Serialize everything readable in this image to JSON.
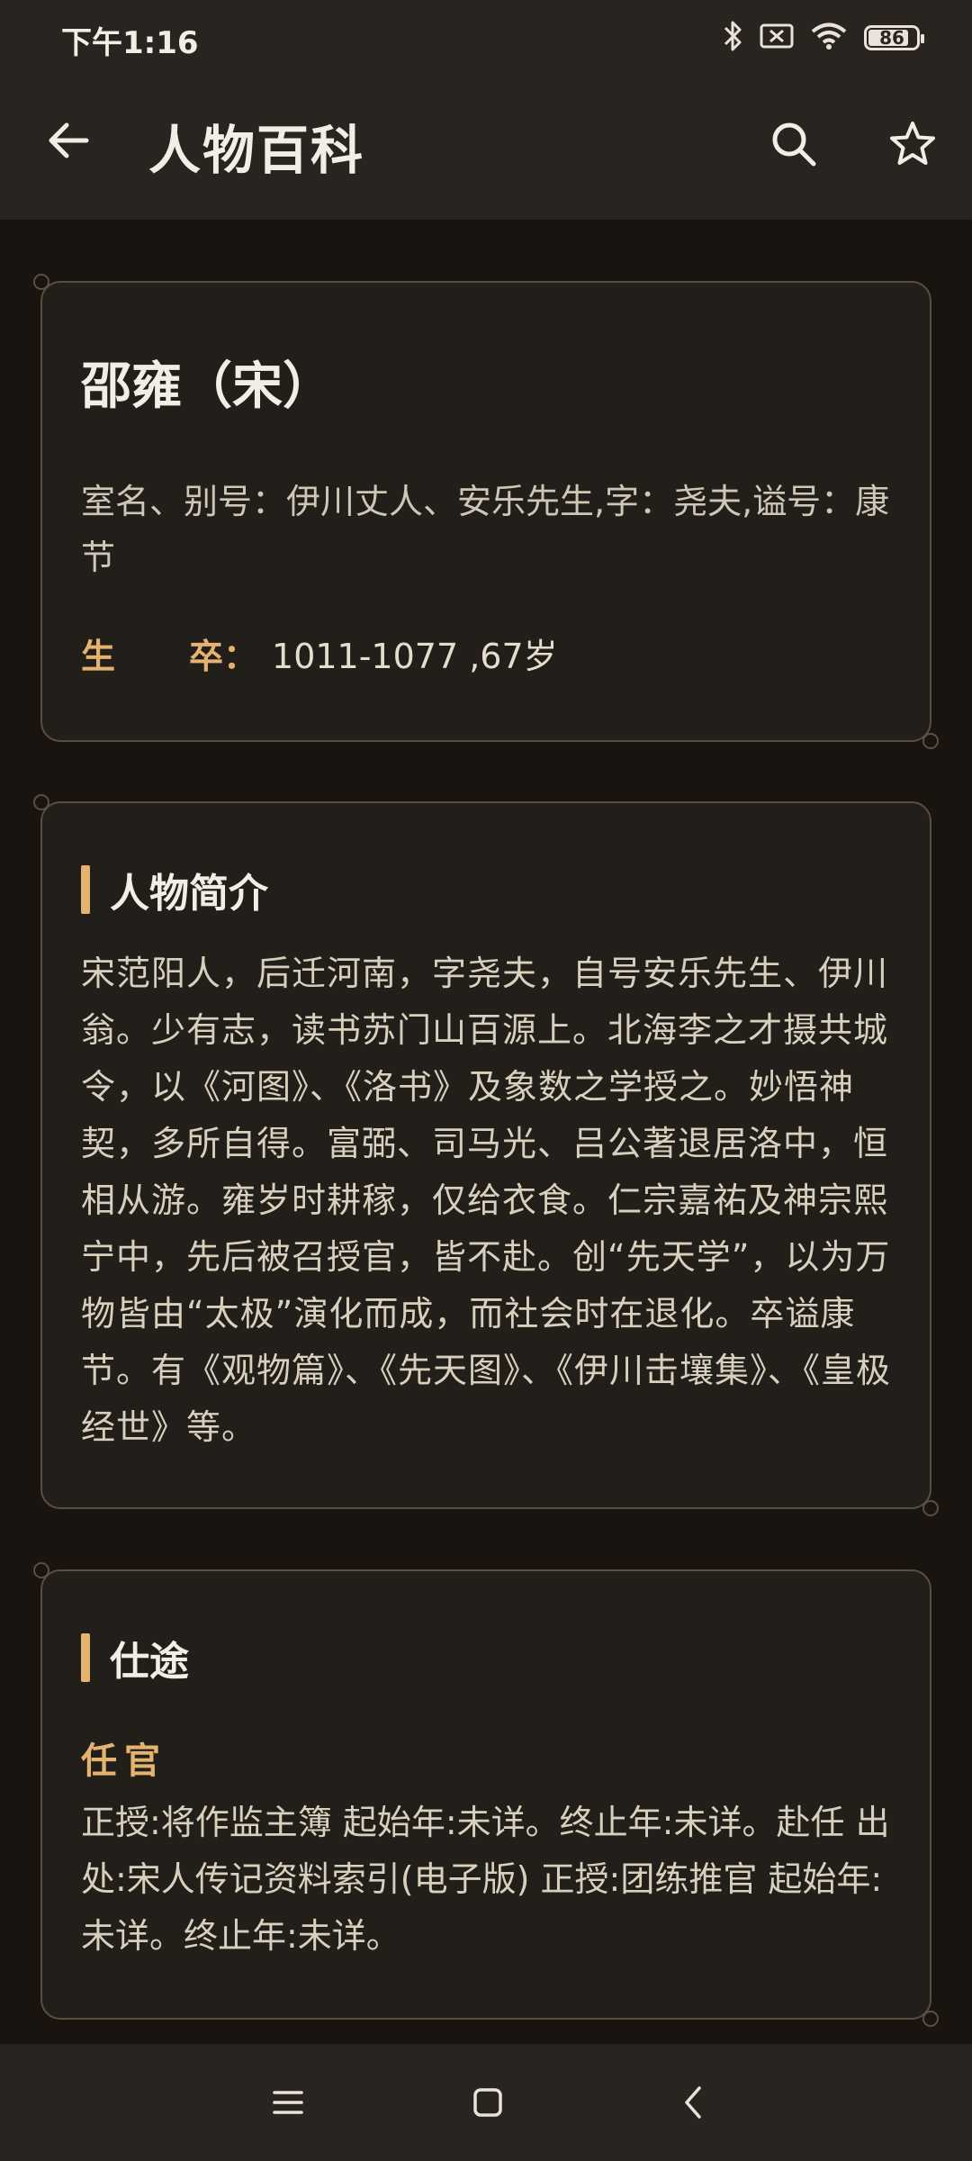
{
  "status_bar": {
    "time": "下午1:16",
    "battery": "86",
    "battery_level": 0.86,
    "icons": [
      "bluetooth-icon",
      "sim-off-icon",
      "wifi-icon",
      "battery-icon"
    ]
  },
  "app_bar": {
    "title": "人物百科",
    "back_icon": "arrow-left-icon",
    "search_icon": "search-icon",
    "favorite_icon": "star-outline-icon"
  },
  "profile": {
    "name": "邵雍（宋）",
    "aliases": "室名、别号：伊川丈人、安乐先生,字：尧夫,谥号：康节",
    "birth_label_1": "生",
    "birth_label_2": "卒：",
    "birth_value": "1011-1077 ,67岁"
  },
  "bio": {
    "title": "人物简介",
    "text": "宋范阳人，后迁河南，字尧夫，自号安乐先生、伊川翁。少有志，读书苏门山百源上。北海李之才摄共城令，以《河图》、《洛书》及象数之学授之。妙悟神契，多所自得。富弼、司马光、吕公著退居洛中，恒相从游。雍岁时耕稼，仅给衣食。仁宗嘉祐及神宗熙宁中，先后被召授官，皆不赴。创“先天学”，以为万物皆由“太极”演化而成，而社会时在退化。卒谥康节。有《观物篇》、《先天图》、《伊川击壤集》、《皇极经世》等。"
  },
  "career": {
    "title": "仕途",
    "subtitle": "任官",
    "text": "正授:将作监主簿 起始年:未详。终止年:未详。赴任 出处:宋人传记资料索引(电子版) 正授:团练推官 起始年:未详。终止年:未详。"
  },
  "colors": {
    "background": "#1a1410",
    "bar": "#2a2421",
    "card": "#221f1a",
    "accent": "#e4b36f",
    "text": "#e6dccb"
  },
  "nav_bar": {
    "icons": [
      "menu-icon",
      "home-icon",
      "back-icon"
    ]
  }
}
